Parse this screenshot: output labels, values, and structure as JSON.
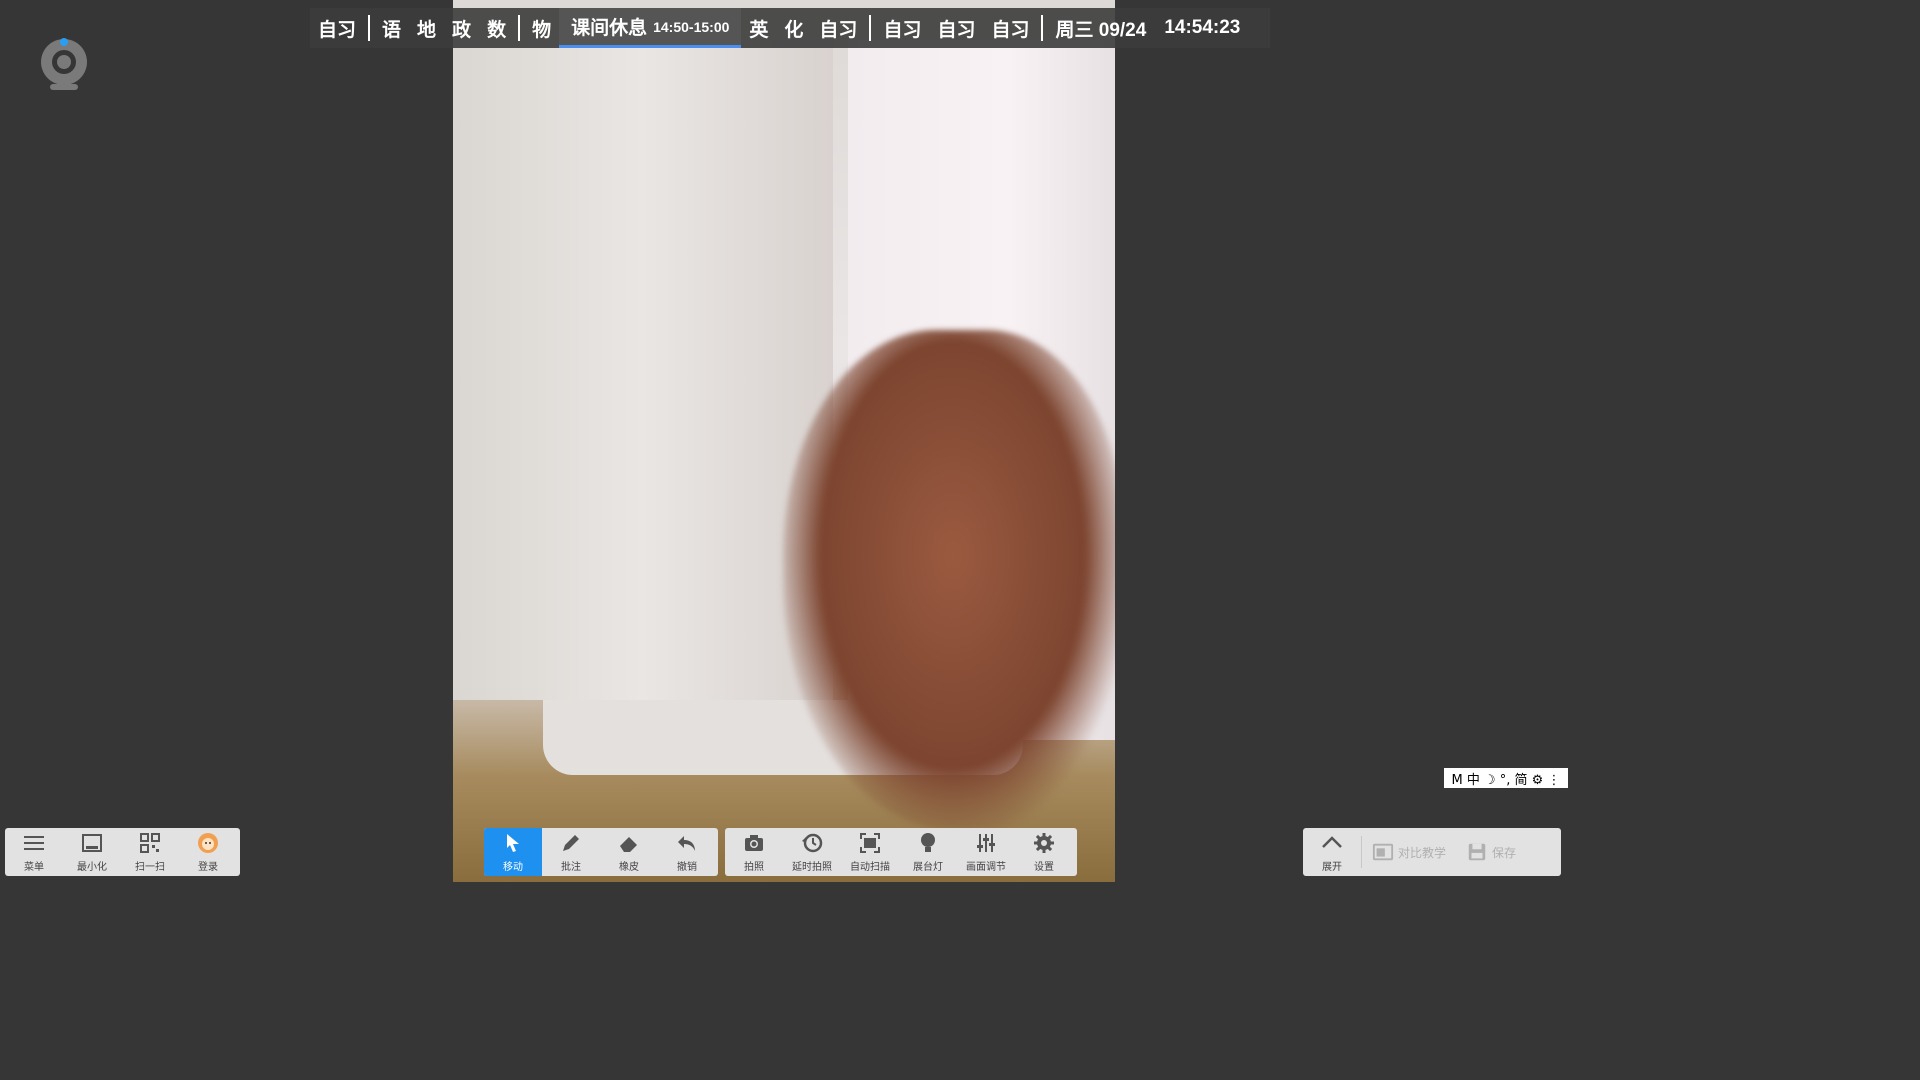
{
  "schedule": {
    "items": [
      "自习",
      "语",
      "地",
      "政",
      "数",
      "物"
    ],
    "current_label": "课间休息",
    "current_time": "14:50-15:00",
    "items_after": [
      "英",
      "化",
      "自习"
    ],
    "extra": [
      "自习",
      "自习",
      "自习"
    ],
    "date": "周三 09/24",
    "time": "14:54:23"
  },
  "ime": {
    "text": "M 中 ☽ °, 简 ⚙ ⋮"
  },
  "left_toolbar": [
    {
      "label": "菜单",
      "icon": "menu-icon"
    },
    {
      "label": "最小化",
      "icon": "minimize-icon"
    },
    {
      "label": "扫一扫",
      "icon": "qr-scan-icon"
    },
    {
      "label": "登录",
      "icon": "avatar-icon"
    }
  ],
  "edit_toolbar": [
    {
      "label": "移动",
      "icon": "pointer-icon",
      "active": true
    },
    {
      "label": "批注",
      "icon": "pen-icon"
    },
    {
      "label": "橡皮",
      "icon": "eraser-icon"
    },
    {
      "label": "撤销",
      "icon": "undo-icon"
    }
  ],
  "camera_toolbar": [
    {
      "label": "拍照",
      "icon": "camera-icon"
    },
    {
      "label": "延时拍照",
      "icon": "timer-icon"
    },
    {
      "label": "自动扫描",
      "icon": "auto-scan-icon"
    },
    {
      "label": "展台灯",
      "icon": "lamp-icon"
    },
    {
      "label": "画面调节",
      "icon": "adjust-icon"
    },
    {
      "label": "设置",
      "icon": "gear-icon"
    }
  ],
  "right_toolbar": {
    "expand": "展开",
    "compare": "对比教学",
    "save": "保存"
  },
  "colors": {
    "accent": "#1e90f0",
    "background": "#363636",
    "toolbar": "#e2e2e2"
  }
}
